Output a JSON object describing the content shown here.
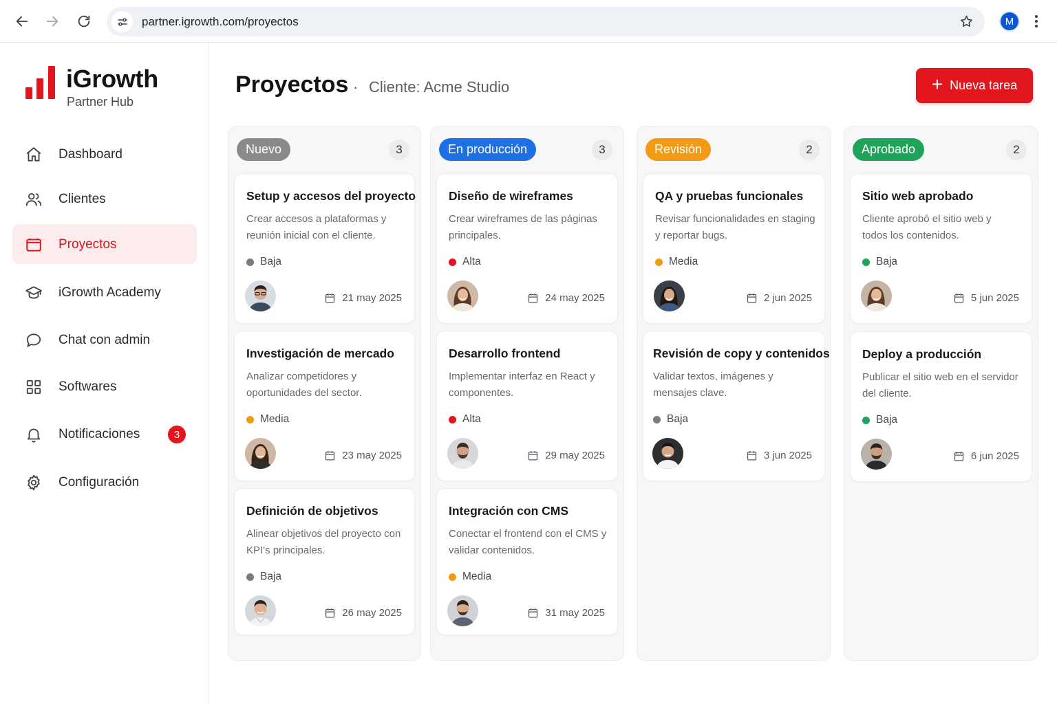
{
  "browser": {
    "url": "partner.igrowth.com/proyectos",
    "profile_initial": "M"
  },
  "brand": {
    "name": "iGrowth",
    "subtitle": "Partner Hub",
    "accent": "#e3161e"
  },
  "sidebar": {
    "items": [
      {
        "label": "Dashboard",
        "icon": "home-icon"
      },
      {
        "label": "Clientes",
        "icon": "users-icon"
      },
      {
        "label": "Proyectos",
        "icon": "folder-icon",
        "active": true
      },
      {
        "label": "iGrowth Academy",
        "icon": "graduation-cap-icon"
      },
      {
        "label": "Chat con admin",
        "icon": "chat-bubble-icon"
      },
      {
        "label": "Softwares",
        "icon": "grid-icon"
      },
      {
        "label": "Notificaciones",
        "icon": "bell-icon",
        "badge": "3"
      },
      {
        "label": "Configuración",
        "icon": "gear-icon"
      }
    ]
  },
  "header": {
    "title": "Proyectos",
    "separator": "·",
    "client": "Cliente: Acme Studio",
    "new_button": "Nueva tarea"
  },
  "columns": [
    {
      "label": "Nuevo",
      "count": "3",
      "color": "#8a8a8a",
      "cards": [
        {
          "title": "Setup y accesos del proyecto",
          "desc": "Crear accesos a plataformas y reunión inicial con el cliente.",
          "priority": "Baja",
          "date": "21 may 2025"
        },
        {
          "title": "Investigación de mercado",
          "desc": "Analizar competidores y oportunidades del sector.",
          "priority": "Media",
          "date": "23 may 2025"
        },
        {
          "title": "Definición de objetivos",
          "desc": "Alinear objetivos del proyecto con KPI's principales.",
          "priority": "Baja",
          "date": "26 may 2025"
        }
      ]
    },
    {
      "label": "En producción",
      "count": "3",
      "color": "#1f6fe5",
      "cards": [
        {
          "title": "Diseño de wireframes",
          "desc": "Crear wireframes de las páginas principales.",
          "priority": "Alta",
          "date": "24 may 2025"
        },
        {
          "title": "Desarrollo frontend",
          "desc": "Implementar interfaz en React y componentes.",
          "priority": "Alta",
          "date": "29 may 2025"
        },
        {
          "title": "Integración con CMS",
          "desc": "Conectar el frontend con el CMS y validar contenidos.",
          "priority": "Media",
          "date": "31 may 2025"
        }
      ]
    },
    {
      "label": "Revisión",
      "count": "2",
      "color": "#f29a14",
      "cards": [
        {
          "title": "QA y pruebas funcionales",
          "desc": "Revisar funcionalidades en staging y reportar bugs.",
          "priority": "Media",
          "date": "2 jun 2025"
        },
        {
          "title": "Revisión de copy y contenidos",
          "desc": "Validar textos, imágenes y mensajes clave.",
          "priority": "Baja",
          "date": "3 jun 2025"
        }
      ]
    },
    {
      "label": "Aprobado",
      "count": "2",
      "color": "#1fa35a",
      "cards": [
        {
          "title": "Sitio web aprobado",
          "desc": "Cliente aprobó el sitio web y todos los contenidos.",
          "priority": "Baja",
          "date": "5 jun 2025"
        },
        {
          "title": "Deploy a producción",
          "desc": "Publicar el sitio web en el servidor del cliente.",
          "priority": "Baja",
          "date": "6 jun 2025"
        }
      ]
    }
  ],
  "priority_colors": {
    "Baja": "#7b7b7b",
    "Media": "#f29a14",
    "Alta": "#e3161e",
    "Baja-green": "#1fa35a"
  }
}
